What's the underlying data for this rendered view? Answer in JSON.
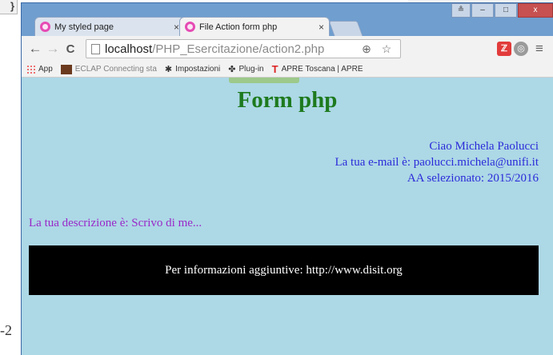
{
  "slide": {
    "corner_glyph": "}",
    "left_fragment": "-2"
  },
  "window": {
    "controls": [
      "≗",
      "–",
      "□",
      "x"
    ]
  },
  "tabs": [
    {
      "title": "My styled page",
      "close": "×",
      "active": false
    },
    {
      "title": "File Action form php",
      "close": "×",
      "active": true
    }
  ],
  "toolbar": {
    "back": "←",
    "forward": "→",
    "reload": "C",
    "url_host": "localhost",
    "url_path": "/PHP_Esercitazione/action2.php",
    "icons": [
      "zoom-icon",
      "star-icon",
      "red-extension-icon",
      "grey-extension-icon",
      "menu-icon"
    ],
    "zoom": "⊕",
    "star": "☆",
    "ext_red": "ℤ",
    "ext_grey": "◎",
    "menu": "≡"
  },
  "bookmarks": [
    {
      "label": "App"
    },
    {
      "label": "ECLAP Connecting sta"
    },
    {
      "label": "Impostazioni"
    },
    {
      "label": "Plug-in"
    },
    {
      "label": "APRE Toscana | APRE"
    }
  ],
  "page": {
    "heading": "Form php",
    "greeting": "Ciao Michela Paolucci",
    "email_line": "La tua e-mail è: paolucci.michela@unifi.it",
    "year_line": "AA selezionato: 2015/2016",
    "description": "La tua descrizione è: Scrivo di me...",
    "footer": "Per informazioni aggiuntive: http://www.disit.org",
    "colors": {
      "background": "#add8e6",
      "heading": "#1e7a1e",
      "info": "#2b2bd9",
      "description": "#9a29c9",
      "footer_bg": "#000000",
      "footer_text": "#ffffff"
    }
  }
}
